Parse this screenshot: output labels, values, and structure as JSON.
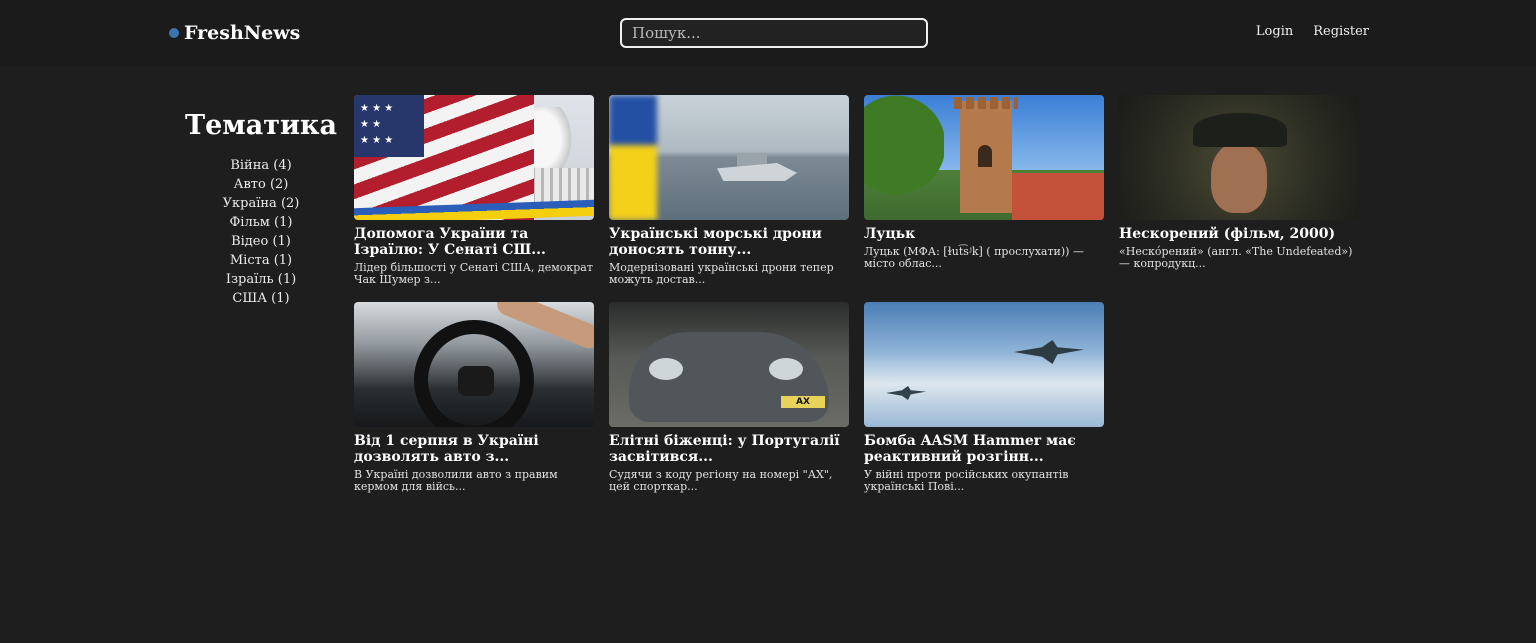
{
  "header": {
    "logo_text": "FreshNews",
    "search_placeholder": "Пошук...",
    "nav": {
      "login": "Login",
      "register": "Register"
    }
  },
  "sidebar": {
    "title": "Тематика",
    "topics": [
      "Війна (4)",
      "Авто (2)",
      "Україна (2)",
      "Фільм (1)",
      "Відео (1)",
      "Міста (1)",
      "Ізраїль (1)",
      "США (1)"
    ]
  },
  "articles": [
    {
      "title": "Допомога України та Ізраїлю: У Сенаті СШ...",
      "excerpt": "Лідер більшості у Сенаті США, демократ Чак Шумер з..."
    },
    {
      "title": "Українські морські дрони доносять тонну...",
      "excerpt": "Модернізовані українські дрони тепер можуть достав..."
    },
    {
      "title": "Луцьк",
      "excerpt": "Луцьк (МФА: [ɫut͡sʲk] ( прослухати)) — місто облас..."
    },
    {
      "title": "Нескорений (фільм, 2000)",
      "excerpt": "«Нескóрений» (англ. «The Undefeated») — копродукц..."
    },
    {
      "title": "Від 1 серпня в Україні дозволять авто з...",
      "excerpt": "В Україні дозволили авто з правим кермом для війсь..."
    },
    {
      "title": "Елітні біженці: у Португалії засвітився...",
      "excerpt": "Судячи з коду регіону на номері \"АХ\", цей спорткар..."
    },
    {
      "title": "Бомба AASM Hammer має реактивний розгінн...",
      "excerpt": "У війні проти російських окупантів українські Пові..."
    }
  ],
  "thumb_plate_text": "AX",
  "colors": {
    "background": "#1e1e1f",
    "header_background": "#1b1b1c",
    "logo_dot": "#3b74b0",
    "text": "#ffffff"
  }
}
